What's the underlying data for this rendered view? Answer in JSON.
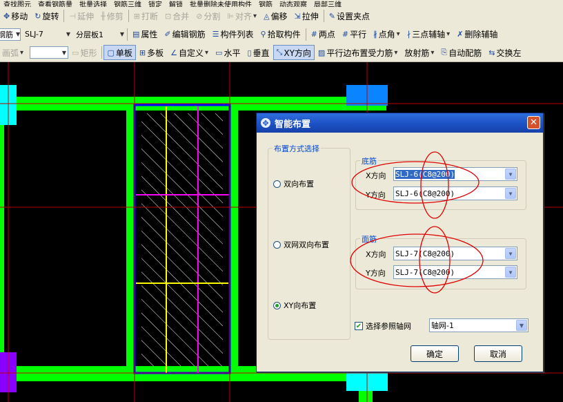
{
  "toolbar_top": {
    "items": [
      "查找图元",
      "查看钢筋量",
      "批量选择",
      "钢筋三维",
      "锁定",
      "解锁",
      "批量删除未使用构件",
      "钢筋",
      "动态观察",
      "局部三维"
    ]
  },
  "toolbar1": {
    "move": "移动",
    "rotate": "旋转",
    "extend": "延伸",
    "trim": "修剪",
    "break": "打断",
    "merge": "合并",
    "split": "分割",
    "align": "对齐",
    "offset": "偏移",
    "stretch": "拉伸",
    "setpoint": "设置夹点"
  },
  "toolbar2": {
    "type_combo": "钢筋",
    "name_combo": "SLJ-7",
    "layer_combo": "分层板1",
    "props": "属性",
    "edit_rebar": "编辑钢筋",
    "comp_list": "构件列表",
    "pick": "拾取构件",
    "two_point": "两点",
    "parallel": "平行",
    "point_angle": "点角",
    "three_point_axis": "三点辅轴",
    "delete_axis": "删除辅轴"
  },
  "toolbar3": {
    "arc": "画弧",
    "rect": "矩形",
    "single": "单板",
    "multi": "多板",
    "custom": "自定义",
    "horizontal": "水平",
    "vertical": "垂直",
    "xy": "XY方向",
    "parallel_edge": "平行边布置受力筋",
    "radial": "放射筋",
    "auto": "自动配筋",
    "swap": "交换左"
  },
  "dialog": {
    "title": "智能布置",
    "close": "✕",
    "group_mode": "布置方式选择",
    "opt_two_way": "双向布置",
    "opt_double_net": "双网双向布置",
    "opt_xy": "XY向布置",
    "group_bottom": "底筋",
    "group_top": "面筋",
    "x_label": "X方向",
    "y_label": "Y方向",
    "bottom_x": "SLJ-6(C8@200)",
    "bottom_y": "SLJ-6(C8@200)",
    "top_x": "SLJ-7(C8@200)",
    "top_y": "SLJ-7(C8@200)",
    "ref_axis_label": "选择参照轴网",
    "ref_axis_value": "轴网-1",
    "ok": "确定",
    "cancel": "取消"
  },
  "colors": {
    "slab_green": "#00ff00",
    "axis_red": "#c00000",
    "dim_yellow": "#ffff00",
    "rebar_magenta": "#ff00ff",
    "selection_blue": "#0000ff",
    "annotation_red": "#e00000"
  }
}
